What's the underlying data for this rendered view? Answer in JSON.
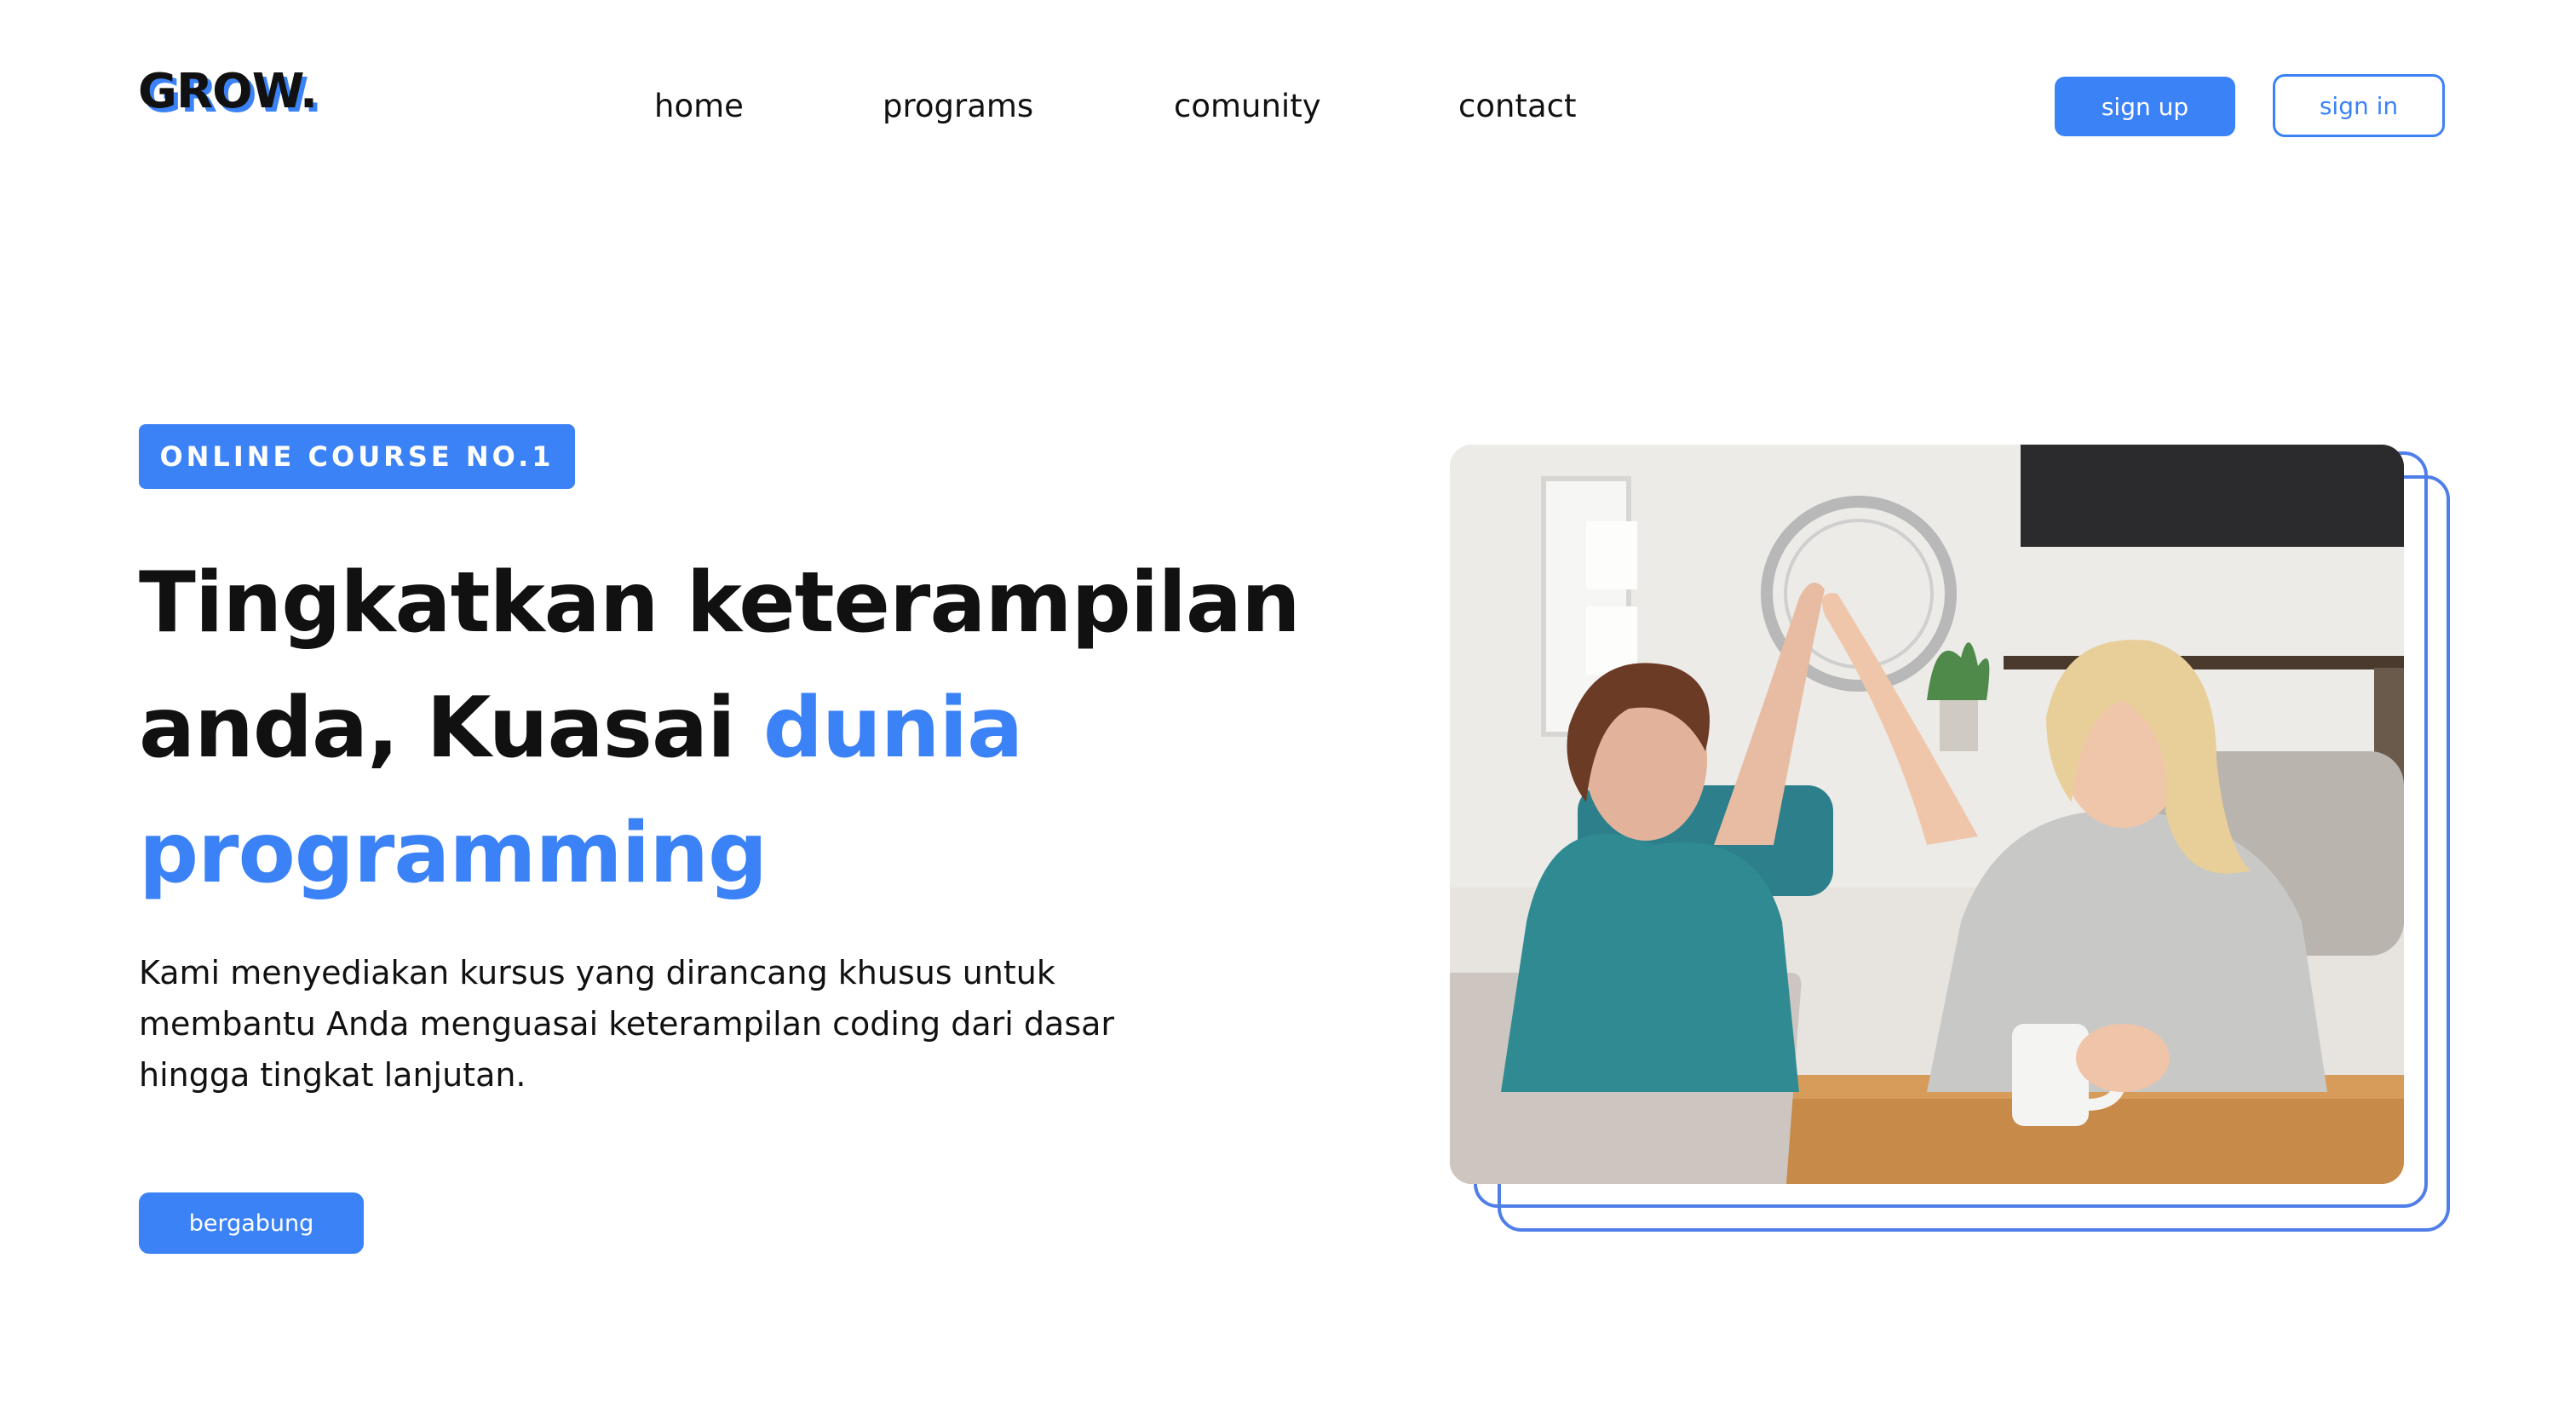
{
  "brand": {
    "logo_text": "GROW.",
    "accent_color": "#3b82f6"
  },
  "nav": {
    "items": [
      {
        "label": "home"
      },
      {
        "label": "programs"
      },
      {
        "label": "comunity"
      },
      {
        "label": "contact"
      }
    ],
    "sign_up_label": "sign up",
    "sign_in_label": "sign in"
  },
  "hero": {
    "badge": "ONLINE COURSE NO.1",
    "headline_part1": "Tingkatkan keterampilan anda, Kuasai ",
    "headline_accent": "dunia programming",
    "description": "Kami menyediakan kursus yang dirancang khusus untuk membantu Anda menguasai keterampilan coding dari dasar hingga tingkat lanjutan.",
    "cta_label": "bergabung"
  },
  "image": {
    "icon": "high-five-photo"
  }
}
